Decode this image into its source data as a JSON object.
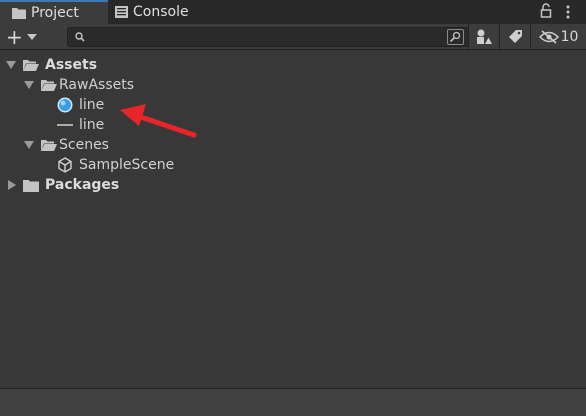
{
  "tabs": [
    {
      "label": "Project",
      "icon": "folder-icon",
      "active": true
    },
    {
      "label": "Console",
      "icon": "console-icon",
      "active": false
    }
  ],
  "toolbar": {
    "add_label": "+",
    "search": {
      "value": "",
      "placeholder": ""
    },
    "hidden_count": "10"
  },
  "tree": {
    "assets": {
      "label": "Assets"
    },
    "rawassets": {
      "label": "RawAssets"
    },
    "line_material": {
      "label": "line"
    },
    "line_mesh": {
      "label": "line"
    },
    "scenes": {
      "label": "Scenes"
    },
    "samplescene": {
      "label": "SampleScene"
    },
    "packages": {
      "label": "Packages"
    }
  },
  "colors": {
    "accent": "#3a79bb",
    "annotation": "#e8262a"
  }
}
